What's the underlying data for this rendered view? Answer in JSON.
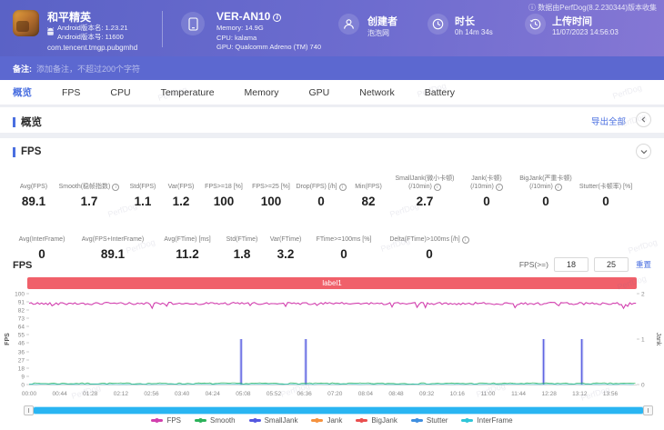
{
  "header": {
    "app": {
      "name": "和平精英",
      "android_version": "Android版本名: 1.23.21",
      "android_build": "Android版本号: 11600",
      "package": "com.tencent.tmgp.pubgmhd"
    },
    "device": {
      "model": "VER-AN10",
      "memory": "Memory: 14.9G",
      "cpu": "CPU: kalama",
      "gpu": "GPU: Qualcomm Adreno (TM) 740"
    },
    "creator": {
      "label": "创建者",
      "value": "泡泡网"
    },
    "duration": {
      "label": "时长",
      "value": "0h 14m 34s"
    },
    "upload": {
      "label": "上传时间",
      "value": "11/07/2023 14:56:03"
    },
    "collected_note": "数据由PerfDog(8.2.230344)版本收集"
  },
  "note_bar": {
    "label": "备注:",
    "placeholder": "添加备注，不超过200个字符"
  },
  "tabs": [
    {
      "label": "概览",
      "active": true
    },
    {
      "label": "FPS",
      "active": false
    },
    {
      "label": "CPU",
      "active": false
    },
    {
      "label": "Temperature",
      "active": false
    },
    {
      "label": "Memory",
      "active": false
    },
    {
      "label": "GPU",
      "active": false
    },
    {
      "label": "Network",
      "active": false
    },
    {
      "label": "Battery",
      "active": false
    }
  ],
  "overview": {
    "title": "概览",
    "export_label": "导出全部"
  },
  "fps_section": {
    "title": "FPS"
  },
  "stats_row1": [
    {
      "label": "Avg(FPS)",
      "value": "89.1"
    },
    {
      "label": "Smooth(稳帧指数)",
      "info": true,
      "value": "1.7"
    },
    {
      "label": "Std(FPS)",
      "value": "1.1"
    },
    {
      "label": "Var(FPS)",
      "value": "1.2"
    },
    {
      "label": "FPS>=18 [%]",
      "value": "100"
    },
    {
      "label": "FPS>=25 [%]",
      "value": "100"
    },
    {
      "label": "Drop(FPS) [/h]",
      "info": true,
      "value": "0"
    },
    {
      "label": "Min(FPS)",
      "value": "82"
    },
    {
      "label": "SmallJank(微小卡顿)",
      "label2": "(/10min)",
      "info": true,
      "value": "2.7"
    },
    {
      "label": "Jank(卡顿)",
      "label2": "(/10min)",
      "info": true,
      "value": "0"
    },
    {
      "label": "BigJank(严重卡顿)",
      "label2": "(/10min)",
      "info": true,
      "value": "0"
    },
    {
      "label": "Stutter(卡顿率) [%]",
      "value": "0"
    }
  ],
  "stats_row2": [
    {
      "label": "Avg(InterFrame)",
      "value": "0"
    },
    {
      "label": "Avg(FPS+InterFrame)",
      "value": "89.1"
    },
    {
      "label": "Avg(FTime) [ms]",
      "value": "11.2"
    },
    {
      "label": "Std(FTime)",
      "value": "1.8"
    },
    {
      "label": "Var(FTime)",
      "value": "3.2"
    },
    {
      "label": "FTime>=100ms [%]",
      "value": "0"
    },
    {
      "label": "Delta(FTime)>100ms [/h]",
      "info": true,
      "value": "0"
    }
  ],
  "chart_controls": {
    "title": "FPS",
    "threshold_label": "FPS(>=)",
    "threshold1": "18",
    "threshold2": "25",
    "reset_label": "重置"
  },
  "chart_data": {
    "type": "line",
    "title": "FPS",
    "annotation": {
      "text": "label1",
      "color": "#f0606a"
    },
    "x_ticks": [
      "00:00",
      "00:44",
      "01:28",
      "02:12",
      "02:56",
      "03:40",
      "04:24",
      "05:08",
      "05:52",
      "06:36",
      "07:20",
      "08:04",
      "08:48",
      "09:32",
      "10:16",
      "11:00",
      "11:44",
      "12:28",
      "13:12",
      "13:56"
    ],
    "x_interval_s": 44,
    "x_range_s": [
      0,
      874
    ],
    "y_left": {
      "label": "FPS",
      "range": [
        0,
        100
      ],
      "ticks": [
        0,
        9,
        18,
        27,
        36,
        46,
        55,
        64,
        73,
        82,
        91,
        100
      ]
    },
    "y_right": {
      "label": "Jank",
      "range": [
        0,
        2
      ],
      "ticks": [
        0,
        1,
        2
      ]
    },
    "series": [
      {
        "name": "FPS",
        "axis": "left",
        "color": "#d23fae",
        "approx_avg": 89.1,
        "approx_min": 82,
        "approx_max": 91
      },
      {
        "name": "Smooth",
        "axis": "left",
        "color": "#2cb25a",
        "approx_avg": 1.7
      },
      {
        "name": "SmallJank",
        "axis": "right",
        "color": "#5558e0",
        "events_s": [
          305,
          398,
          740,
          795
        ],
        "event_value": 1
      },
      {
        "name": "Jank",
        "axis": "right",
        "color": "#f5923e",
        "approx_avg": 0
      },
      {
        "name": "BigJank",
        "axis": "right",
        "color": "#ea4f4f",
        "approx_avg": 0
      },
      {
        "name": "Stutter",
        "axis": "right",
        "color": "#3f8fe0",
        "approx_avg": 0
      },
      {
        "name": "InterFrame",
        "axis": "left",
        "color": "#2fc6d8",
        "approx_avg": 0
      }
    ],
    "legend_position": "bottom",
    "grid": false
  },
  "watermark": "PerfDog"
}
